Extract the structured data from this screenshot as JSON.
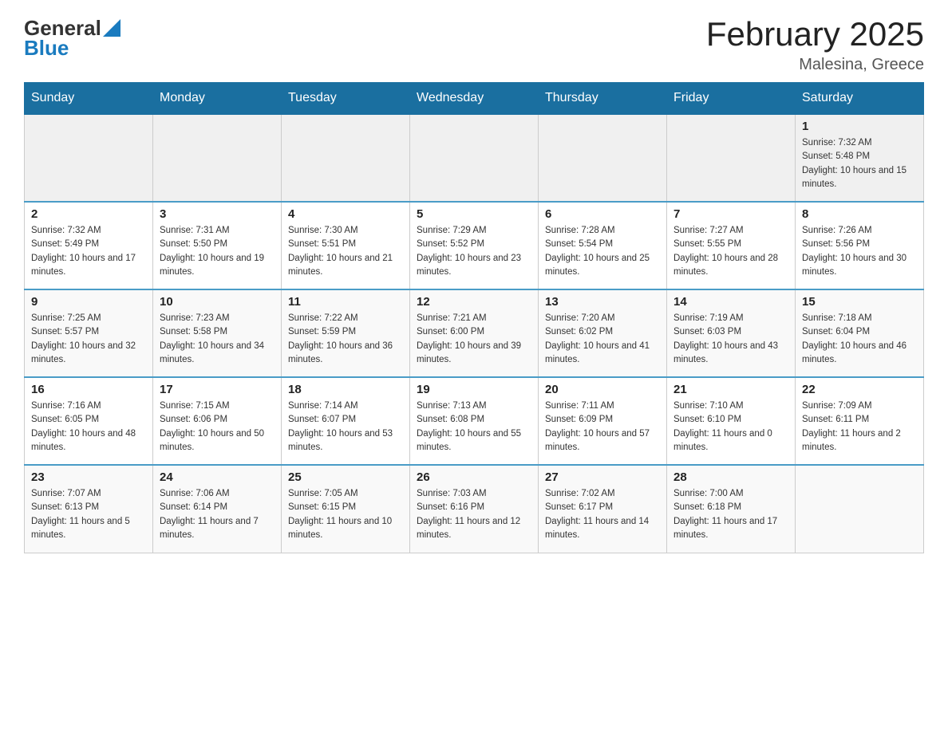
{
  "header": {
    "logo_general": "General",
    "logo_blue": "Blue",
    "month_year": "February 2025",
    "location": "Malesina, Greece"
  },
  "weekdays": [
    "Sunday",
    "Monday",
    "Tuesday",
    "Wednesday",
    "Thursday",
    "Friday",
    "Saturday"
  ],
  "weeks": [
    [
      {
        "day": "",
        "sunrise": "",
        "sunset": "",
        "daylight": ""
      },
      {
        "day": "",
        "sunrise": "",
        "sunset": "",
        "daylight": ""
      },
      {
        "day": "",
        "sunrise": "",
        "sunset": "",
        "daylight": ""
      },
      {
        "day": "",
        "sunrise": "",
        "sunset": "",
        "daylight": ""
      },
      {
        "day": "",
        "sunrise": "",
        "sunset": "",
        "daylight": ""
      },
      {
        "day": "",
        "sunrise": "",
        "sunset": "",
        "daylight": ""
      },
      {
        "day": "1",
        "sunrise": "Sunrise: 7:32 AM",
        "sunset": "Sunset: 5:48 PM",
        "daylight": "Daylight: 10 hours and 15 minutes."
      }
    ],
    [
      {
        "day": "2",
        "sunrise": "Sunrise: 7:32 AM",
        "sunset": "Sunset: 5:49 PM",
        "daylight": "Daylight: 10 hours and 17 minutes."
      },
      {
        "day": "3",
        "sunrise": "Sunrise: 7:31 AM",
        "sunset": "Sunset: 5:50 PM",
        "daylight": "Daylight: 10 hours and 19 minutes."
      },
      {
        "day": "4",
        "sunrise": "Sunrise: 7:30 AM",
        "sunset": "Sunset: 5:51 PM",
        "daylight": "Daylight: 10 hours and 21 minutes."
      },
      {
        "day": "5",
        "sunrise": "Sunrise: 7:29 AM",
        "sunset": "Sunset: 5:52 PM",
        "daylight": "Daylight: 10 hours and 23 minutes."
      },
      {
        "day": "6",
        "sunrise": "Sunrise: 7:28 AM",
        "sunset": "Sunset: 5:54 PM",
        "daylight": "Daylight: 10 hours and 25 minutes."
      },
      {
        "day": "7",
        "sunrise": "Sunrise: 7:27 AM",
        "sunset": "Sunset: 5:55 PM",
        "daylight": "Daylight: 10 hours and 28 minutes."
      },
      {
        "day": "8",
        "sunrise": "Sunrise: 7:26 AM",
        "sunset": "Sunset: 5:56 PM",
        "daylight": "Daylight: 10 hours and 30 minutes."
      }
    ],
    [
      {
        "day": "9",
        "sunrise": "Sunrise: 7:25 AM",
        "sunset": "Sunset: 5:57 PM",
        "daylight": "Daylight: 10 hours and 32 minutes."
      },
      {
        "day": "10",
        "sunrise": "Sunrise: 7:23 AM",
        "sunset": "Sunset: 5:58 PM",
        "daylight": "Daylight: 10 hours and 34 minutes."
      },
      {
        "day": "11",
        "sunrise": "Sunrise: 7:22 AM",
        "sunset": "Sunset: 5:59 PM",
        "daylight": "Daylight: 10 hours and 36 minutes."
      },
      {
        "day": "12",
        "sunrise": "Sunrise: 7:21 AM",
        "sunset": "Sunset: 6:00 PM",
        "daylight": "Daylight: 10 hours and 39 minutes."
      },
      {
        "day": "13",
        "sunrise": "Sunrise: 7:20 AM",
        "sunset": "Sunset: 6:02 PM",
        "daylight": "Daylight: 10 hours and 41 minutes."
      },
      {
        "day": "14",
        "sunrise": "Sunrise: 7:19 AM",
        "sunset": "Sunset: 6:03 PM",
        "daylight": "Daylight: 10 hours and 43 minutes."
      },
      {
        "day": "15",
        "sunrise": "Sunrise: 7:18 AM",
        "sunset": "Sunset: 6:04 PM",
        "daylight": "Daylight: 10 hours and 46 minutes."
      }
    ],
    [
      {
        "day": "16",
        "sunrise": "Sunrise: 7:16 AM",
        "sunset": "Sunset: 6:05 PM",
        "daylight": "Daylight: 10 hours and 48 minutes."
      },
      {
        "day": "17",
        "sunrise": "Sunrise: 7:15 AM",
        "sunset": "Sunset: 6:06 PM",
        "daylight": "Daylight: 10 hours and 50 minutes."
      },
      {
        "day": "18",
        "sunrise": "Sunrise: 7:14 AM",
        "sunset": "Sunset: 6:07 PM",
        "daylight": "Daylight: 10 hours and 53 minutes."
      },
      {
        "day": "19",
        "sunrise": "Sunrise: 7:13 AM",
        "sunset": "Sunset: 6:08 PM",
        "daylight": "Daylight: 10 hours and 55 minutes."
      },
      {
        "day": "20",
        "sunrise": "Sunrise: 7:11 AM",
        "sunset": "Sunset: 6:09 PM",
        "daylight": "Daylight: 10 hours and 57 minutes."
      },
      {
        "day": "21",
        "sunrise": "Sunrise: 7:10 AM",
        "sunset": "Sunset: 6:10 PM",
        "daylight": "Daylight: 11 hours and 0 minutes."
      },
      {
        "day": "22",
        "sunrise": "Sunrise: 7:09 AM",
        "sunset": "Sunset: 6:11 PM",
        "daylight": "Daylight: 11 hours and 2 minutes."
      }
    ],
    [
      {
        "day": "23",
        "sunrise": "Sunrise: 7:07 AM",
        "sunset": "Sunset: 6:13 PM",
        "daylight": "Daylight: 11 hours and 5 minutes."
      },
      {
        "day": "24",
        "sunrise": "Sunrise: 7:06 AM",
        "sunset": "Sunset: 6:14 PM",
        "daylight": "Daylight: 11 hours and 7 minutes."
      },
      {
        "day": "25",
        "sunrise": "Sunrise: 7:05 AM",
        "sunset": "Sunset: 6:15 PM",
        "daylight": "Daylight: 11 hours and 10 minutes."
      },
      {
        "day": "26",
        "sunrise": "Sunrise: 7:03 AM",
        "sunset": "Sunset: 6:16 PM",
        "daylight": "Daylight: 11 hours and 12 minutes."
      },
      {
        "day": "27",
        "sunrise": "Sunrise: 7:02 AM",
        "sunset": "Sunset: 6:17 PM",
        "daylight": "Daylight: 11 hours and 14 minutes."
      },
      {
        "day": "28",
        "sunrise": "Sunrise: 7:00 AM",
        "sunset": "Sunset: 6:18 PM",
        "daylight": "Daylight: 11 hours and 17 minutes."
      },
      {
        "day": "",
        "sunrise": "",
        "sunset": "",
        "daylight": ""
      }
    ]
  ]
}
